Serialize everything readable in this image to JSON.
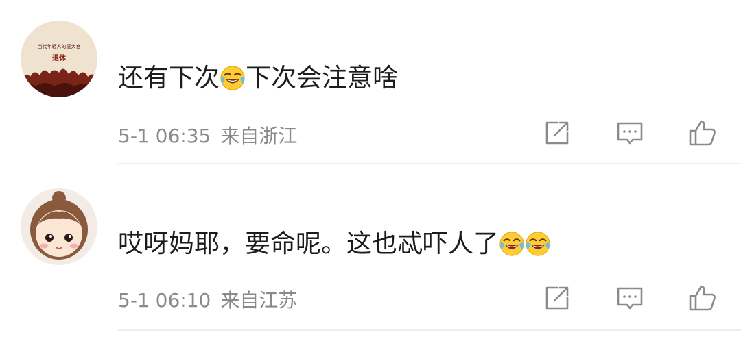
{
  "comments": [
    {
      "avatar_caption": "当代年轻人的征大官",
      "avatar_title": "退休",
      "text_parts": [
        "还有下次",
        "下次会注意啥"
      ],
      "emoji": "laughing-tears-emoji",
      "time": "5-1 06:35",
      "location": "来自浙江"
    },
    {
      "text_parts": [
        "哎呀妈耶，要命呢。这也忒吓人了"
      ],
      "emoji": "laughing-tears-emoji",
      "time": "5-1 06:10",
      "location": "来自江苏"
    }
  ],
  "icons": {
    "share": "share-icon",
    "comment": "comment-icon",
    "like": "thumbs-up-icon"
  },
  "colors": {
    "text": "#1c1c1c",
    "meta": "#8a8a8a",
    "icon": "#8a8a8a",
    "divider": "#eeeeee"
  }
}
